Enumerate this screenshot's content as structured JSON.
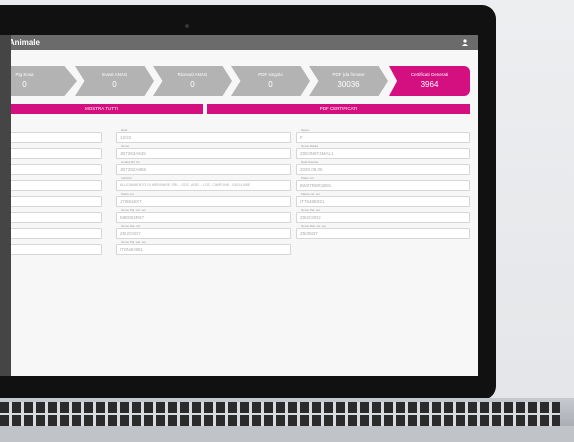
{
  "window": {
    "title": "ti Animale"
  },
  "steps": [
    {
      "label": "Pig Sosa",
      "value": "0"
    },
    {
      "label": "Invest ANAG",
      "value": "0"
    },
    {
      "label": "Ricevuti ANAG",
      "value": "0"
    },
    {
      "label": "PDF singolo",
      "value": "0"
    },
    {
      "label": "PDF (da firmare",
      "value": "30036"
    },
    {
      "label": "Certificati Generati",
      "value": "3964"
    }
  ],
  "buttons": {
    "show_all": "MOSTRA TUTTI",
    "pdf_cert": "PDF CERTIFICATI"
  },
  "fields_mid": [
    {
      "label": "Data",
      "value": "12/22"
    },
    {
      "label": "Nome",
      "value": "JB7283A845"
    },
    {
      "label": "Codice Ril. Ex",
      "value": "JB728ZA865"
    },
    {
      "label": "Indirizzo",
      "value": "ALLEVAMENTO DI MERIVARE SRL - SOC. AGR. - LOC. CIMPONE - 03014 ABE"
    },
    {
      "label": "Padre col.",
      "value": "J7I6916X7"
    },
    {
      "label": "Nome Pat. col. ser",
      "value": "M6D0I4R67"
    },
    {
      "label": "Nome Nat. col.",
      "value": "Z5I2C8O7"
    },
    {
      "label": "Nome Pat. pat. ser",
      "value": "IT0N4H951"
    }
  ],
  "fields_right": [
    {
      "label": "Sesso",
      "value": "F"
    },
    {
      "label": "Nome Madre",
      "value": "Z0E3N9T4MAL1"
    },
    {
      "label": "Data Nascita",
      "value": "2020.09.05"
    },
    {
      "label": "Padre col.",
      "value": "8W27R6R1B91"
    },
    {
      "label": "Madre col. ser",
      "value": "IT7548E821"
    },
    {
      "label": "Nome Pat. ser",
      "value": "Z0I2C8O2"
    },
    {
      "label": "Nome Mat. col. ser",
      "value": "Z5I3M37"
    }
  ]
}
